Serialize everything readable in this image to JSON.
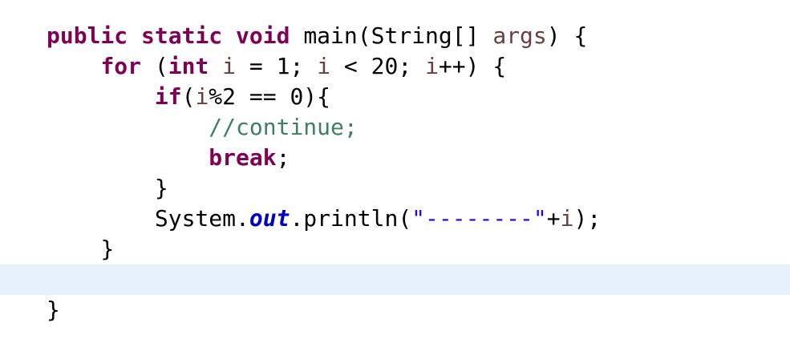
{
  "colors": {
    "keyword": "#7f0055",
    "local_variable": "#6a3e3e",
    "comment": "#3f7f5f",
    "string": "#2a00ff",
    "static_field": "#0000c0",
    "current_line_highlight": "#e8f2fe"
  },
  "code": {
    "l1": {
      "indent": "",
      "kw1": "public",
      "kw2": "static",
      "kw3": "void",
      "t1": "main(String[] ",
      "v1": "args",
      "t2": ") {"
    },
    "l2": {
      "indent": "    ",
      "kw1": "for",
      "t1": " (",
      "kw2": "int",
      "v1": "i",
      "t2": " = 1; ",
      "v2": "i",
      "t3": " < 20; ",
      "v3": "i",
      "t4": "++) {"
    },
    "l3": {
      "indent": "        ",
      "kw1": "if",
      "t1": "(",
      "v1": "i",
      "t2": "%2 == 0){"
    },
    "l4": {
      "indent": "            ",
      "comment": "//continue;"
    },
    "l5": {
      "indent": "            ",
      "kw1": "break",
      "t1": ";"
    },
    "l6": {
      "indent": "        ",
      "t1": "}"
    },
    "l7": {
      "indent": "        ",
      "t1": "System.",
      "field": "out",
      "t2": ".println(",
      "str": "\"--------\"",
      "t3": "+",
      "v1": "i",
      "t4": ");"
    },
    "l8": {
      "indent": "    ",
      "t1": "}"
    },
    "l9": {
      "indent": ""
    },
    "l10": {
      "indent": "",
      "t1": "}"
    }
  }
}
